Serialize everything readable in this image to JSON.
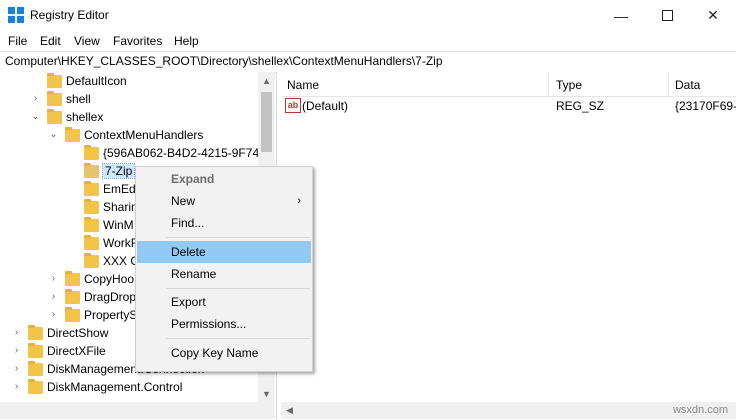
{
  "window": {
    "title": "Registry Editor",
    "icon": "registry-editor-icon",
    "controls": [
      "minimize",
      "maximize",
      "close"
    ]
  },
  "menu": [
    "File",
    "Edit",
    "View",
    "Favorites",
    "Help"
  ],
  "address": "Computer\\HKEY_CLASSES_ROOT\\Directory\\shellex\\ContextMenuHandlers\\7-Zip",
  "tree": [
    {
      "label": "DefaultIcon",
      "twisty": ""
    },
    {
      "label": "shell",
      "twisty": "›"
    },
    {
      "label": "shellex",
      "twisty": "⌄"
    },
    {
      "label": "ContextMenuHandlers",
      "twisty": "⌄"
    },
    {
      "label": "{596AB062-B4D2-4215-9F74-",
      "twisty": ""
    },
    {
      "label": "7-Zip",
      "twisty": "",
      "selected": true
    },
    {
      "label": "EmEd",
      "twisty": ""
    },
    {
      "label": "Sharin",
      "twisty": ""
    },
    {
      "label": "WinM",
      "twisty": ""
    },
    {
      "label": "WorkF",
      "twisty": ""
    },
    {
      "label": "XXX G",
      "twisty": ""
    },
    {
      "label": "CopyHoo",
      "twisty": "›"
    },
    {
      "label": "DragDrop",
      "twisty": "›"
    },
    {
      "label": "PropertyS",
      "twisty": "›"
    },
    {
      "label": "DirectShow",
      "twisty": "›"
    },
    {
      "label": "DirectXFile",
      "twisty": "›"
    },
    {
      "label": "DiskManagement.Connection",
      "twisty": "›"
    },
    {
      "label": "DiskManagement.Control",
      "twisty": "›"
    }
  ],
  "list": {
    "headers": [
      "Name",
      "Type",
      "Data"
    ],
    "rows": [
      {
        "name": "(Default)",
        "type": "REG_SZ",
        "data": "{23170F69-"
      }
    ]
  },
  "context_menu": {
    "expand": "Expand",
    "new": "New",
    "find": "Find...",
    "delete": "Delete",
    "rename": "Rename",
    "export": "Export",
    "permissions": "Permissions...",
    "copy_key_name": "Copy Key Name"
  },
  "watermark": "wsxdn.com",
  "colors": {
    "highlight": "#91c9f7",
    "folder": "#f2c54a",
    "accent": "#1a7fd8"
  }
}
